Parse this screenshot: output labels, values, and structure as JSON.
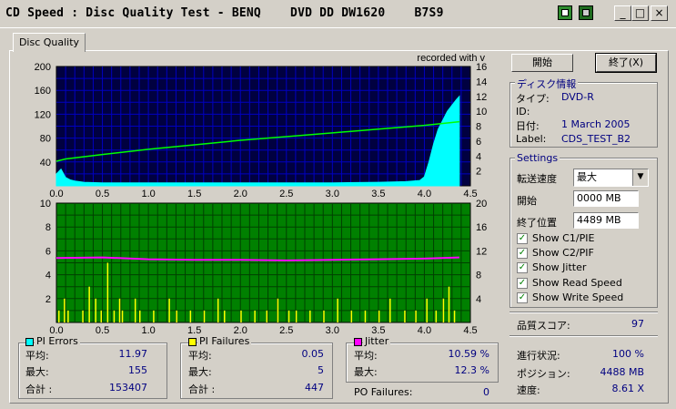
{
  "window": {
    "title": "CD Speed : Disc Quality Test - BENQ    DVD DD DW1620    B7S9",
    "minimize_glyph": "_",
    "maximize_glyph": "□",
    "close_glyph": "×"
  },
  "tabs": [
    {
      "label": "Disc Quality"
    }
  ],
  "buttons": {
    "start": "開始",
    "stop": "終了(X)"
  },
  "disc_info": {
    "title": "ディスク情報",
    "type_label": "タイプ:",
    "type_value": "DVD-R",
    "id_label": "ID:",
    "id_value": "",
    "date_label": "日付:",
    "date_value": "1 March 2005",
    "label_label": "Label:",
    "label_value": "CDS_TEST_B2"
  },
  "settings": {
    "title": "Settings",
    "speed_label": "転送速度",
    "speed_value": "最大",
    "start_label": "開始",
    "start_value": "0000 MB",
    "end_label": "終了位置",
    "end_value": "4489 MB",
    "checks": [
      {
        "label": "Show C1/PIE",
        "checked": true
      },
      {
        "label": "Show C2/PIF",
        "checked": true
      },
      {
        "label": "Show Jitter",
        "checked": true
      },
      {
        "label": "Show Read Speed",
        "checked": true
      },
      {
        "label": "Show Write Speed",
        "checked": true
      }
    ],
    "check_glyph": "✓"
  },
  "quality_score": {
    "label": "品質スコア:",
    "value": "97"
  },
  "progress": {
    "progress_label": "進行状況:",
    "progress_value": "100 %",
    "position_label": "ポジション:",
    "position_value": "4488 MB",
    "speed_label": "速度:",
    "speed_value": "8.61 X"
  },
  "stats": {
    "pi_errors": {
      "title": "PI Errors",
      "color": "#00ffff",
      "avg_label": "平均:",
      "avg": "11.97",
      "max_label": "最大:",
      "max": "155",
      "total_label": "合計 :",
      "total": "153407"
    },
    "pi_failures": {
      "title": "PI Failures",
      "color": "#ffff00",
      "avg_label": "平均:",
      "avg": "0.05",
      "max_label": "最大:",
      "max": "5",
      "total_label": "合計 :",
      "total": "447"
    },
    "jitter": {
      "title": "Jitter",
      "color": "#ff00ff",
      "avg_label": "平均:",
      "avg": "10.59 %",
      "max_label": "最大:",
      "max": "12.3 %"
    },
    "po_failures": {
      "label": "PO Failures:",
      "value": "0"
    }
  },
  "chart_data": [
    {
      "type": "area",
      "title": "",
      "annotation": "recorded with  v",
      "xlim": [
        0,
        4.5
      ],
      "xticks": [
        "0.0",
        "0.5",
        "1.0",
        "1.5",
        "2.0",
        "2.5",
        "3.0",
        "3.5",
        "4.0",
        "4.5"
      ],
      "ylim": [
        0,
        200
      ],
      "yticks": [
        "40",
        "80",
        "120",
        "160",
        "200"
      ],
      "y2lim": [
        0,
        16
      ],
      "y2ticks": [
        "2",
        "4",
        "6",
        "8",
        "10",
        "12",
        "14",
        "16"
      ],
      "colors": {
        "background": "#000040",
        "grid": "#0000c0",
        "pie": "#00ffff",
        "speed": "#00ff00"
      },
      "series": [
        {
          "name": "PI Errors",
          "axis": "left",
          "x": [
            0.0,
            0.05,
            0.1,
            0.15,
            0.2,
            0.3,
            0.5,
            1.0,
            1.5,
            2.0,
            2.5,
            3.0,
            3.5,
            3.8,
            3.95,
            4.0,
            4.05,
            4.1,
            4.15,
            4.2,
            4.25,
            4.3,
            4.35,
            4.38
          ],
          "y": [
            20,
            28,
            14,
            10,
            8,
            6,
            5,
            5,
            5,
            5,
            5,
            5,
            6,
            7,
            9,
            15,
            40,
            70,
            95,
            110,
            125,
            135,
            145,
            150
          ]
        },
        {
          "name": "Read Speed",
          "axis": "right",
          "x": [
            0.0,
            0.1,
            0.5,
            1.0,
            1.5,
            2.0,
            2.5,
            3.0,
            3.5,
            4.0,
            4.38
          ],
          "y": [
            3.3,
            3.6,
            4.2,
            4.9,
            5.5,
            6.1,
            6.6,
            7.1,
            7.6,
            8.1,
            8.6
          ]
        }
      ]
    },
    {
      "type": "bar",
      "title": "",
      "xlim": [
        0,
        4.5
      ],
      "xticks": [
        "0.0",
        "0.5",
        "1.0",
        "1.5",
        "2.0",
        "2.5",
        "3.0",
        "3.5",
        "4.0",
        "4.5"
      ],
      "ylim": [
        0,
        10
      ],
      "yticks": [
        "2",
        "4",
        "6",
        "8",
        "10"
      ],
      "y2lim": [
        0,
        20
      ],
      "y2ticks": [
        "4",
        "8",
        "12",
        "16",
        "20"
      ],
      "colors": {
        "background": "#008000",
        "grid": "#004000",
        "pif": "#ffff00",
        "jitter": "#ff00ff"
      },
      "series": [
        {
          "name": "PI Failures",
          "axis": "left",
          "x": [
            0.02,
            0.08,
            0.12,
            0.28,
            0.35,
            0.42,
            0.48,
            0.55,
            0.62,
            0.68,
            0.71,
            0.85,
            0.9,
            1.05,
            1.22,
            1.3,
            1.45,
            1.6,
            1.75,
            1.82,
            2.0,
            2.15,
            2.28,
            2.4,
            2.52,
            2.6,
            2.75,
            2.9,
            3.05,
            3.2,
            3.35,
            3.5,
            3.62,
            3.78,
            3.9,
            4.02,
            4.12,
            4.2,
            4.26,
            4.32
          ],
          "y": [
            1,
            2,
            1,
            1,
            3,
            2,
            1,
            5,
            1,
            2,
            1,
            2,
            1,
            1,
            2,
            1,
            1,
            1,
            2,
            1,
            1,
            1,
            1,
            2,
            1,
            1,
            1,
            1,
            2,
            1,
            1,
            1,
            2,
            1,
            1,
            2,
            1,
            2,
            3,
            1
          ]
        },
        {
          "name": "Jitter",
          "axis": "right",
          "x": [
            0.0,
            0.5,
            1.0,
            1.5,
            2.0,
            2.5,
            3.0,
            3.5,
            4.0,
            4.38
          ],
          "y": [
            10.8,
            10.9,
            10.6,
            10.5,
            10.5,
            10.4,
            10.5,
            10.6,
            10.7,
            10.9
          ]
        }
      ]
    }
  ]
}
